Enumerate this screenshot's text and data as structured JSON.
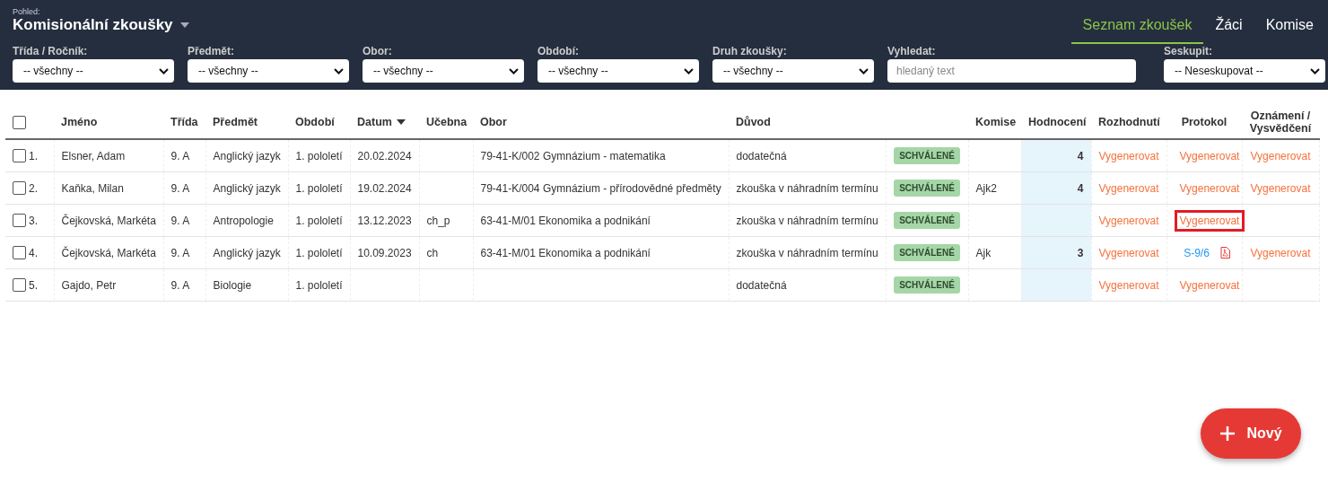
{
  "header": {
    "view_label": "Pohled:",
    "view_title": "Komisionální zkoušky",
    "nav": [
      {
        "label": "Seznam zkoušek",
        "selected": true
      },
      {
        "label": "Žáci",
        "selected": false
      },
      {
        "label": "Komise",
        "selected": false
      }
    ]
  },
  "filters": [
    {
      "kind": "select",
      "label": "Třída / Ročník:",
      "value": "-- všechny --"
    },
    {
      "kind": "select",
      "label": "Předmět:",
      "value": "-- všechny --"
    },
    {
      "kind": "select",
      "label": "Obor:",
      "value": "-- všechny --"
    },
    {
      "kind": "select",
      "label": "Období:",
      "value": "-- všechny --"
    },
    {
      "kind": "select",
      "label": "Druh zkoušky:",
      "value": "-- všechny --"
    },
    {
      "kind": "search",
      "label": "Vyhledat:",
      "placeholder": "hledaný text"
    },
    {
      "kind": "select",
      "label": "Seskupit:",
      "value": "-- Neseskupovat --"
    }
  ],
  "table": {
    "select_all_checked": false,
    "columns": [
      {
        "label": "Jméno"
      },
      {
        "label": "Třída"
      },
      {
        "label": "Předmět"
      },
      {
        "label": "Období"
      },
      {
        "label": "Datum",
        "sorted": true
      },
      {
        "label": "Učebna"
      },
      {
        "label": "Obor"
      },
      {
        "label": "Důvod"
      },
      {
        "label": "Komise"
      },
      {
        "label": "Hodnocení"
      },
      {
        "label": "Rozhodnutí"
      },
      {
        "label": "Protokol"
      },
      {
        "label": "Oznámení / Vysvědčení"
      }
    ],
    "rows": [
      {
        "checked": false,
        "number": "1.",
        "name": "Elsner, Adam",
        "class": "9. A",
        "subject": "Anglický jazyk",
        "period": "1. pololetí",
        "date": "20.02.2024",
        "room": "",
        "field": "79-41-K/002 Gymnázium - matematika",
        "reason": "dodatečná",
        "status": "SCHVÁLENÉ",
        "commission": "",
        "grade": "4",
        "decision": "Vygenerovat",
        "protocol": {
          "kind": "action",
          "text": "Vygenerovat",
          "highlighted": false
        },
        "notice": "Vygenerovat"
      },
      {
        "checked": false,
        "number": "2.",
        "name": "Kaňka, Milan",
        "class": "9. A",
        "subject": "Anglický jazyk",
        "period": "1. pololetí",
        "date": "19.02.2024",
        "room": "",
        "field": "79-41-K/004 Gymnázium - přírodovědné předměty",
        "reason": "zkouška v náhradním termínu",
        "status": "SCHVÁLENÉ",
        "commission": "Ajk2",
        "grade": "4",
        "decision": "Vygenerovat",
        "protocol": {
          "kind": "action",
          "text": "Vygenerovat",
          "highlighted": false
        },
        "notice": "Vygenerovat"
      },
      {
        "checked": false,
        "number": "3.",
        "name": "Čejkovská, Markéta",
        "class": "9. A",
        "subject": "Antropologie",
        "period": "1. pololetí",
        "date": "13.12.2023",
        "room": "ch_p",
        "field": "63-41-M/01 Ekonomika a podnikání",
        "reason": "zkouška v náhradním termínu",
        "status": "SCHVÁLENÉ",
        "commission": "",
        "grade": "",
        "decision": "Vygenerovat",
        "protocol": {
          "kind": "action",
          "text": "Vygenerovat",
          "highlighted": true
        },
        "notice": ""
      },
      {
        "checked": false,
        "number": "4.",
        "name": "Čejkovská, Markéta",
        "class": "9. A",
        "subject": "Anglický jazyk",
        "period": "1. pololetí",
        "date": "10.09.2023",
        "room": "ch",
        "field": "63-41-M/01 Ekonomika a podnikání",
        "reason": "zkouška v náhradním termínu",
        "status": "SCHVÁLENÉ",
        "commission": "Ajk",
        "grade": "3",
        "decision": "Vygenerovat",
        "protocol": {
          "kind": "document",
          "text": "S-9/6",
          "highlighted": false
        },
        "notice": "Vygenerovat"
      },
      {
        "checked": false,
        "number": "5.",
        "name": "Gajdo, Petr",
        "class": "9. A",
        "subject": "Biologie",
        "period": "1. pololetí",
        "date": "",
        "room": "",
        "field": "",
        "reason": "dodatečná",
        "status": "SCHVÁLENÉ",
        "commission": "",
        "grade": "",
        "decision": "Vygenerovat",
        "protocol": {
          "kind": "action",
          "text": "Vygenerovat",
          "highlighted": false
        },
        "notice": ""
      }
    ]
  },
  "new_button": {
    "label": "Nový"
  }
}
